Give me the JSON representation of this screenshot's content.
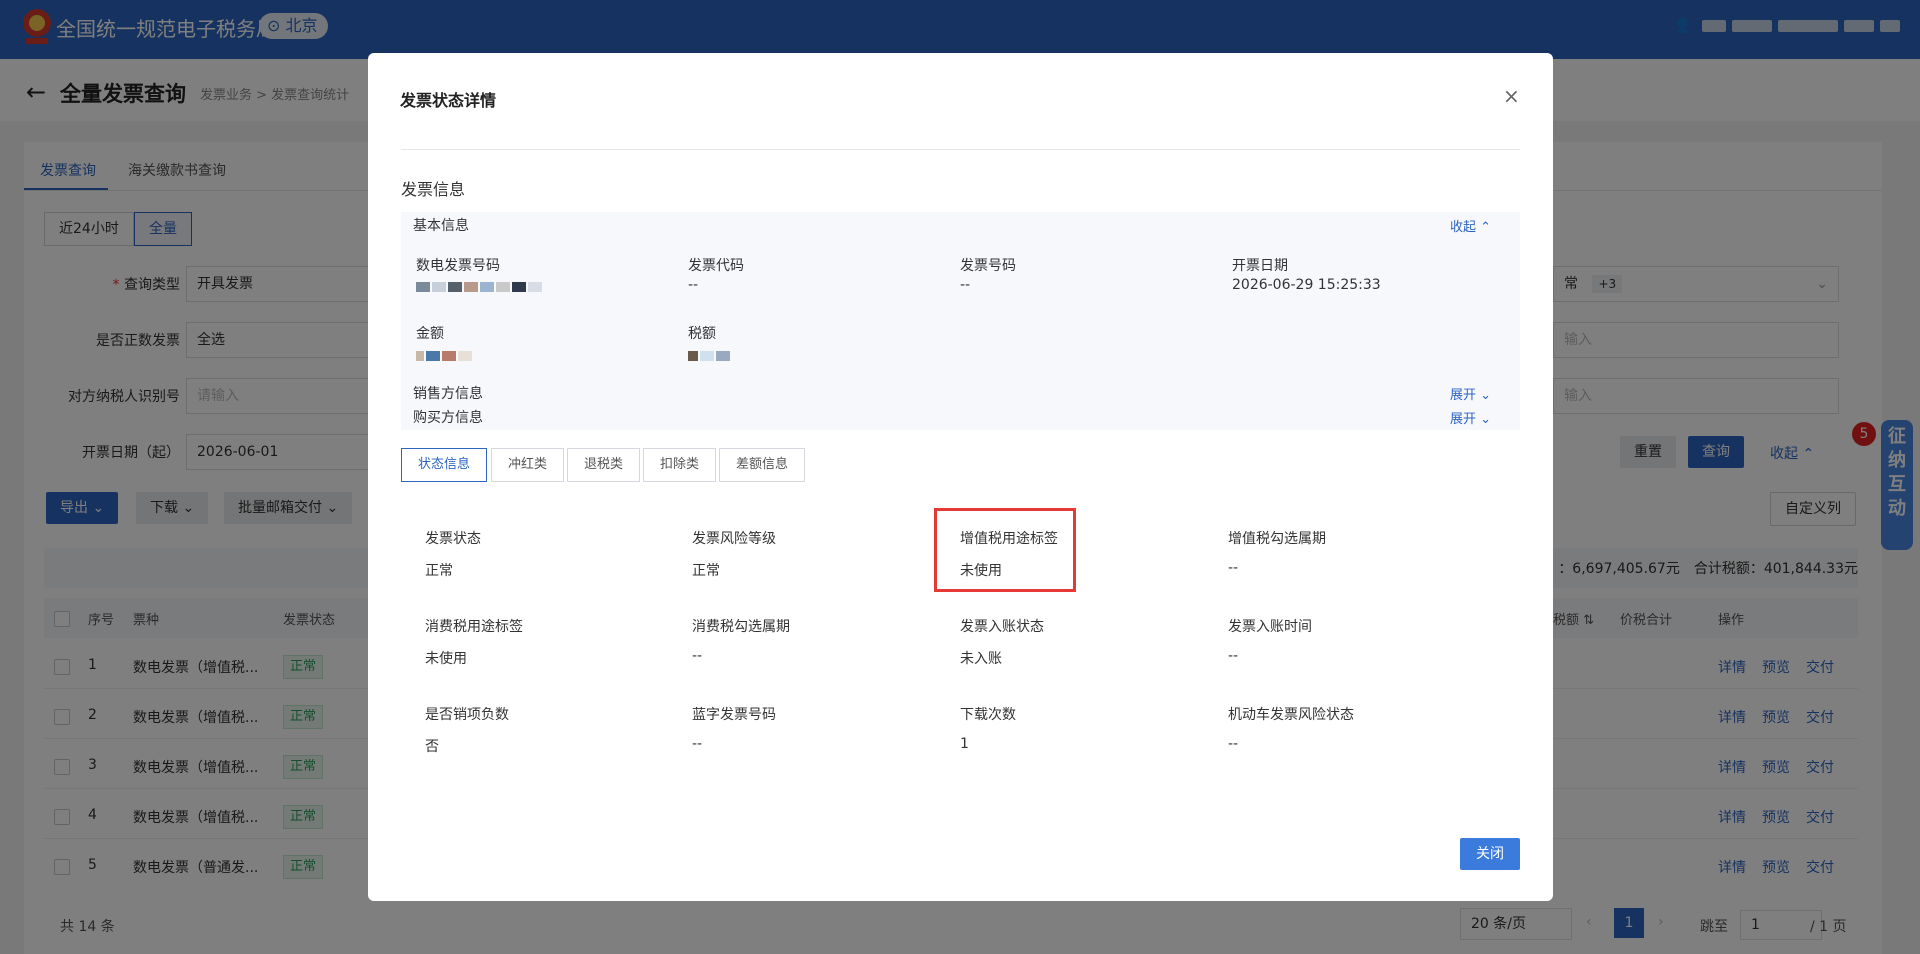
{
  "topbar": {
    "site_title": "全国统一规范电子税务局",
    "location": "北京"
  },
  "page": {
    "title": "全量发票查询",
    "breadcrumb": "发票业务 > 发票查询统计",
    "tabs": [
      "发票查询",
      "海关缴款书查询"
    ],
    "range_buttons": [
      "近24小时",
      "全量"
    ],
    "filters": {
      "query_type_label": "查询类型",
      "query_type_value": "开具发票",
      "is_positive_label": "是否正数发票",
      "is_positive_value": "全选",
      "counterparty_label": "对方纳税人识别号",
      "counterparty_placeholder": "请输入",
      "date_start_label": "开票日期（起）",
      "date_start_value": "2026-06-01",
      "right_status_value": "常",
      "right_status_more": "+3",
      "right_input_1_placeholder": "输入",
      "right_input_2_placeholder": "输入"
    },
    "buttons": {
      "export": "导出",
      "download": "下载",
      "batch_mail": "批量邮箱交付",
      "reset": "重置",
      "query": "查询",
      "collapse": "收起",
      "custom_columns": "自定义列"
    },
    "summary": "：6,697,405.67元　合计税额：401,844.33元",
    "table": {
      "headers": [
        "序号",
        "票种",
        "发票状态",
        "税额",
        "价税合计",
        "操作"
      ],
      "rows": [
        {
          "no": "1",
          "type": "数电发票（增值税...",
          "status": "正常"
        },
        {
          "no": "2",
          "type": "数电发票（增值税...",
          "status": "正常"
        },
        {
          "no": "3",
          "type": "数电发票（增值税...",
          "status": "正常"
        },
        {
          "no": "4",
          "type": "数电发票（增值税...",
          "status": "正常"
        },
        {
          "no": "5",
          "type": "数电发票（普通发...",
          "status": "正常"
        }
      ],
      "ops": [
        "详情",
        "预览",
        "交付"
      ]
    },
    "pager": {
      "total": "共 14 条",
      "page_size": "20 条/页",
      "current": "1",
      "jump_label": "跳至",
      "jump_value": "1",
      "total_pages": "/ 1 页"
    },
    "float_widget": {
      "badge": "5",
      "label": "征纳互动"
    }
  },
  "modal": {
    "title": "发票状态详情",
    "section_title": "发票信息",
    "basic_info_label": "基本信息",
    "collapse_label": "收起",
    "expand_label": "展开",
    "seller_label": "销售方信息",
    "buyer_label": "购买方信息",
    "basic_fields": [
      {
        "label": "数电发票号码",
        "value": ""
      },
      {
        "label": "发票代码",
        "value": "--"
      },
      {
        "label": "发票号码",
        "value": "--"
      },
      {
        "label": "开票日期",
        "value": "2026-06-29 15:25:33"
      },
      {
        "label": "金额",
        "value": ""
      },
      {
        "label": "税额",
        "value": ""
      }
    ],
    "sub_tabs": [
      "状态信息",
      "冲红类",
      "退税类",
      "扣除类",
      "差额信息"
    ],
    "status_fields": [
      {
        "label": "发票状态",
        "value": "正常"
      },
      {
        "label": "发票风险等级",
        "value": "正常"
      },
      {
        "label": "增值税用途标签",
        "value": "未使用"
      },
      {
        "label": "增值税勾选属期",
        "value": "--"
      },
      {
        "label": "消费税用途标签",
        "value": "未使用"
      },
      {
        "label": "消费税勾选属期",
        "value": "--"
      },
      {
        "label": "发票入账状态",
        "value": "未入账"
      },
      {
        "label": "发票入账时间",
        "value": "--"
      },
      {
        "label": "是否销项负数",
        "value": "否"
      },
      {
        "label": "蓝字发票号码",
        "value": "--"
      },
      {
        "label": "下载次数",
        "value": "1"
      },
      {
        "label": "机动车发票风险状态",
        "value": "--"
      }
    ],
    "close_button": "关闭",
    "close_icon": "×"
  },
  "colors": {
    "brand": "#2d65c0",
    "highlight": "#e53935",
    "success": "#2a9d5c"
  }
}
